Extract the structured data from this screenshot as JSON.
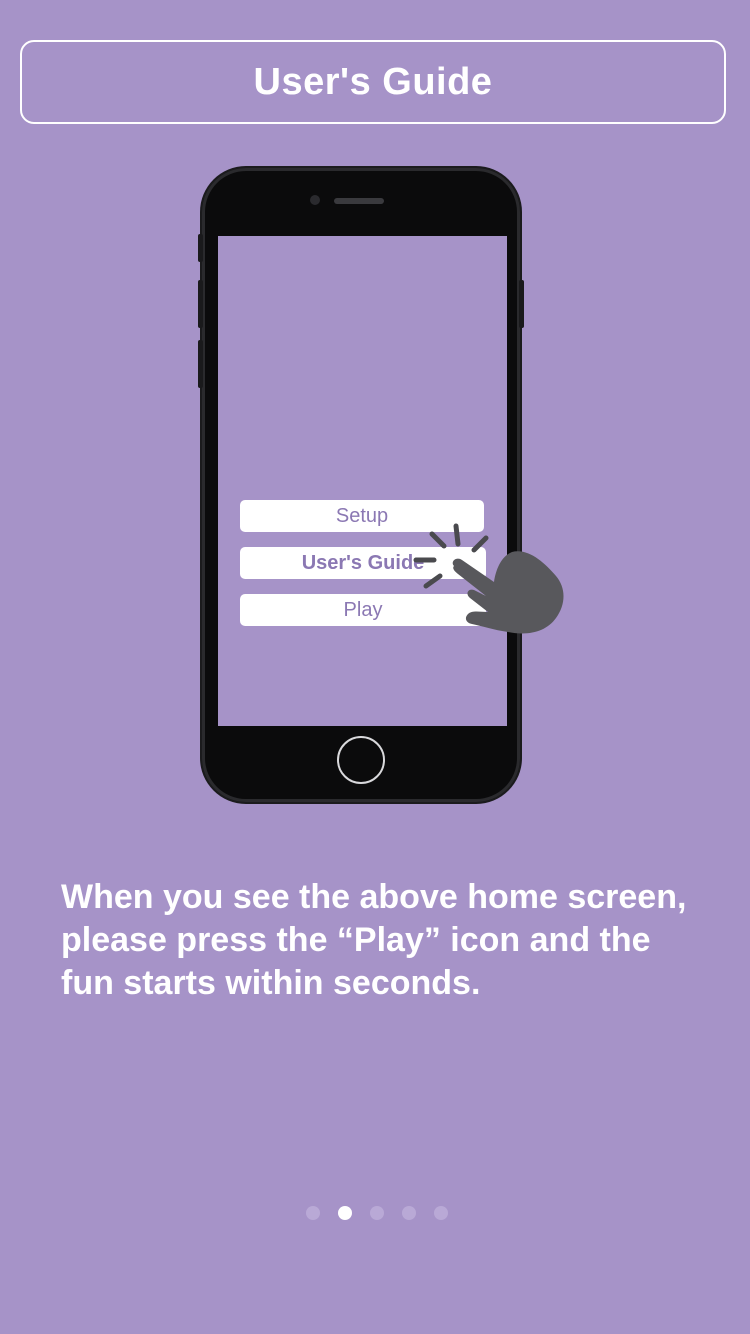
{
  "header": {
    "title": "User's Guide"
  },
  "illustration": {
    "buttons": [
      {
        "label": "Setup"
      },
      {
        "label": "User's Guide"
      },
      {
        "label": "Play"
      }
    ],
    "icon": "tap-hand-icon"
  },
  "description": {
    "text": "When you see the above home screen, please press the “Play” icon and the fun starts within seconds."
  },
  "pager": {
    "total": 5,
    "active_index": 1
  },
  "colors": {
    "background": "#a693c8",
    "text": "#ffffff",
    "mini_button_text": "#8b78b3",
    "dot_inactive": "#b9a9d6",
    "dot_active": "#ffffff"
  }
}
